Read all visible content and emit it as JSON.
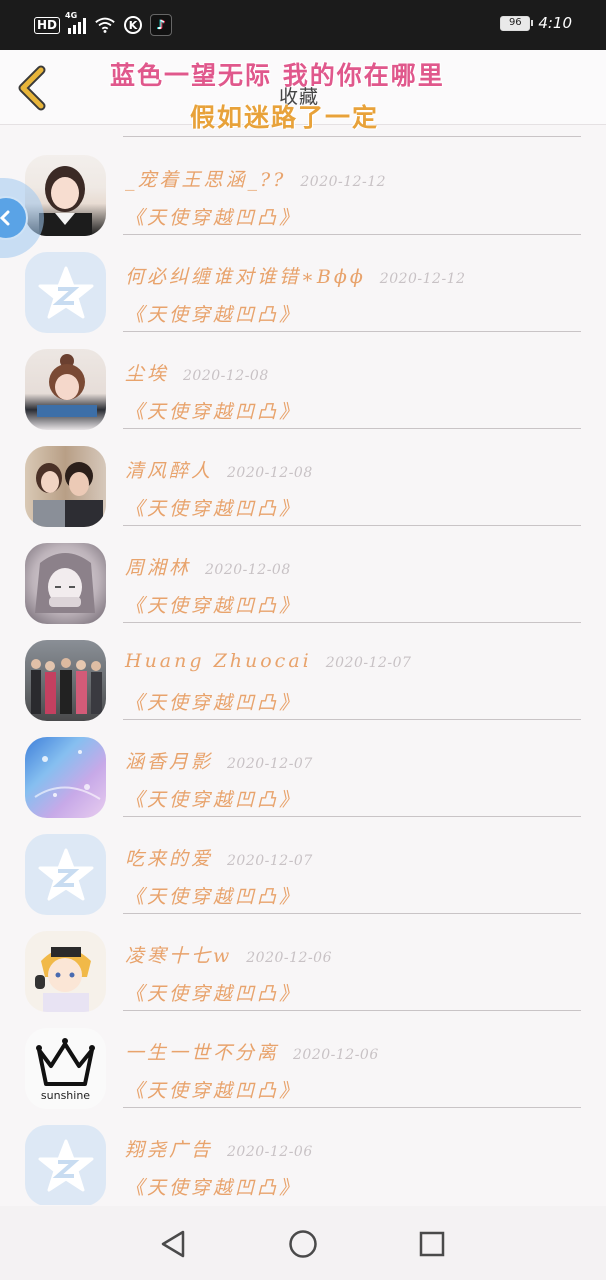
{
  "status_bar": {
    "hd": "HD",
    "network": "4G",
    "k_icon": "K",
    "battery": "96",
    "time": "4:10"
  },
  "header": {
    "banner_line1": "蓝色一望无际 我的你在哪里",
    "banner_line2": "假如迷路了一定",
    "title": "收藏"
  },
  "items": [
    {
      "name": "_宠着王思涵_??",
      "date": "2020-12-12",
      "message": "《天使穿越凹凸》",
      "avatar": "girl-portrait-avatar"
    },
    {
      "name": "何必纠缠谁对谁错∗Βϕϕ",
      "date": "2020-12-12",
      "message": "《天使穿越凹凸》",
      "avatar": "default-star-avatar"
    },
    {
      "name": "尘埃",
      "date": "2020-12-08",
      "message": "《天使穿越凹凸》",
      "avatar": "girl-bun-avatar"
    },
    {
      "name": "清风醉人",
      "date": "2020-12-08",
      "message": "《天使穿越凹凸》",
      "avatar": "couple-photo-avatar"
    },
    {
      "name": "周湘林",
      "date": "2020-12-08",
      "message": "《天使穿越凹凸》",
      "avatar": "anime-girl-avatar"
    },
    {
      "name": "Huang Zhuocai",
      "date": "2020-12-07",
      "message": "《天使穿越凹凸》",
      "avatar": "group-photo-avatar"
    },
    {
      "name": "涵香月影",
      "date": "2020-12-07",
      "message": "《天使穿越凹凸》",
      "avatar": "blue-sky-avatar"
    },
    {
      "name": "吃来的爱",
      "date": "2020-12-07",
      "message": "《天使穿越凹凸》",
      "avatar": "default-star-avatar"
    },
    {
      "name": "凌寒十七w",
      "date": "2020-12-06",
      "message": "《天使穿越凹凸》",
      "avatar": "anime-boy-avatar"
    },
    {
      "name": "一生一世不分离",
      "date": "2020-12-06",
      "message": "《天使穿越凹凸》",
      "avatar": "crown-sunshine-avatar",
      "avatar_text": "sunshine"
    },
    {
      "name": "翔尧广告",
      "date": "2020-12-06",
      "message": "《天使穿越凹凸》",
      "avatar": "default-star-avatar"
    }
  ],
  "colors": {
    "name_text": "#e8a36c",
    "date_text": "#c8c2c5",
    "banner_pink": "#e0588c",
    "banner_orange": "#e8a23a",
    "back_chevron": "#e8b53a"
  }
}
